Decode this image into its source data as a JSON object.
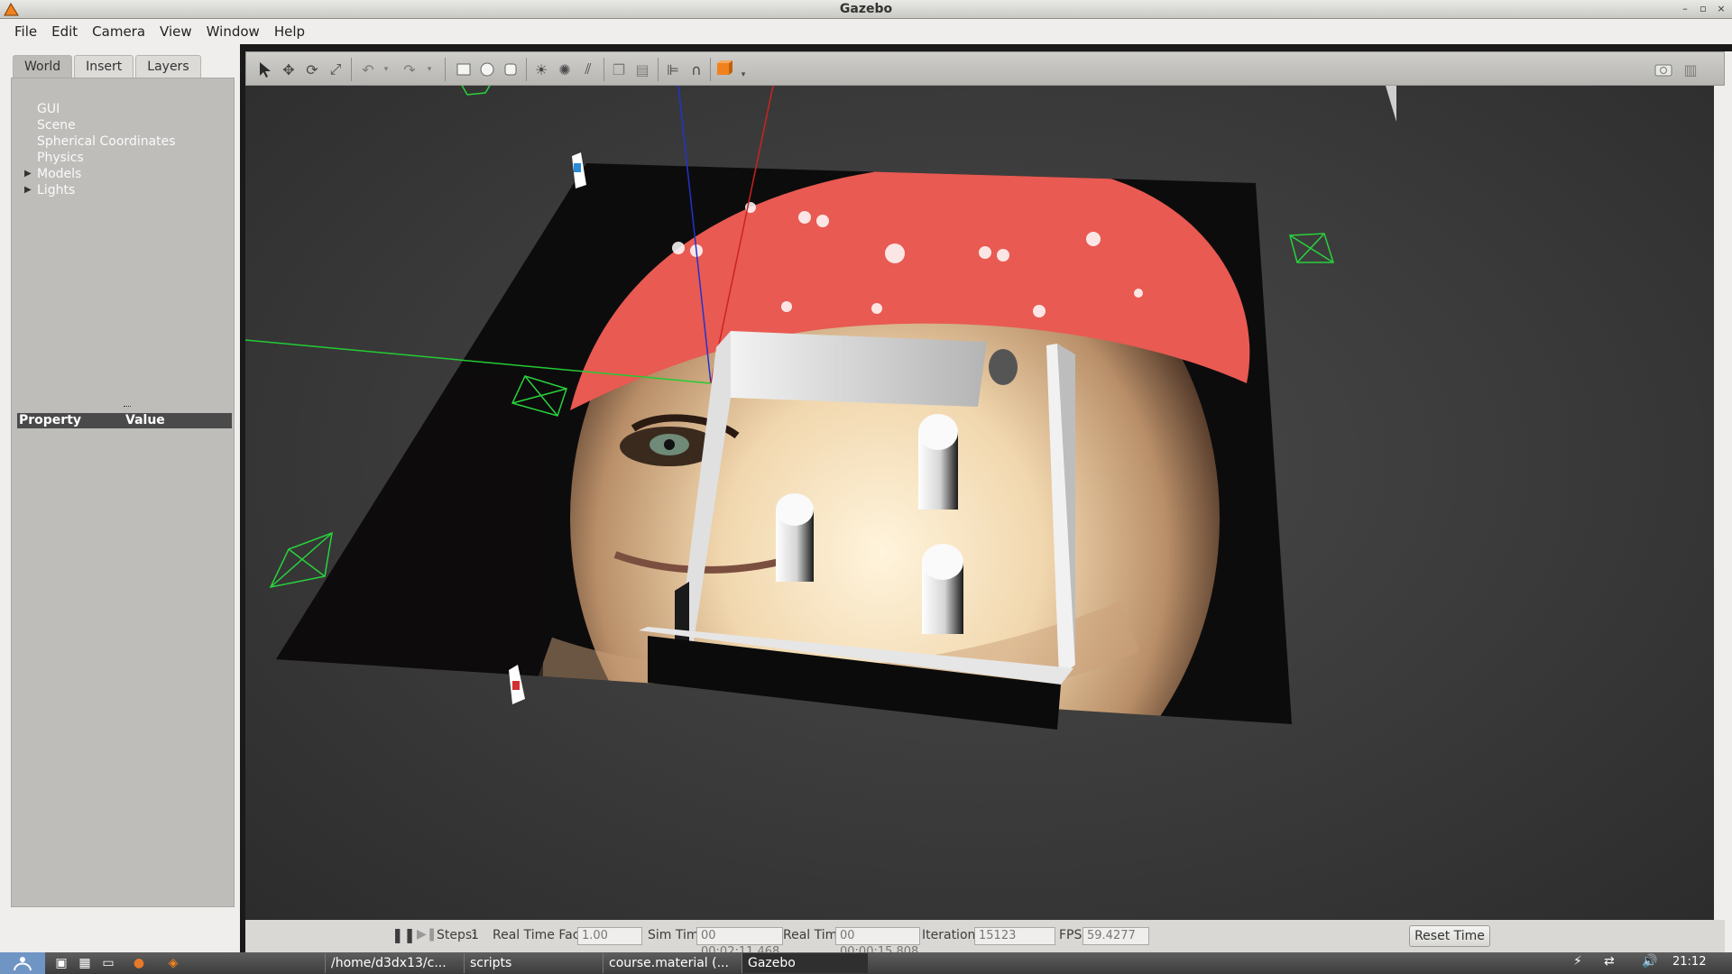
{
  "window": {
    "title": "Gazebo",
    "controls": [
      "–",
      "▫",
      "×"
    ]
  },
  "menu": [
    "File",
    "Edit",
    "Camera",
    "View",
    "Window",
    "Help"
  ],
  "left_panel": {
    "tabs": [
      "World",
      "Insert",
      "Layers"
    ],
    "active_tab": "World",
    "tree": [
      "GUI",
      "Scene",
      "Spherical Coordinates",
      "Physics",
      "Models",
      "Lights"
    ],
    "property_headers": {
      "property": "Property",
      "value": "Value"
    }
  },
  "toolbar": {
    "tools": [
      "select-icon",
      "translate-icon",
      "rotate-icon",
      "scale-icon",
      "undo-icon",
      "redo-icon",
      "box-icon",
      "sphere-icon",
      "cylinder-icon",
      "point-light-icon",
      "spot-light-icon",
      "directional-light-icon",
      "copy-icon",
      "paste-icon",
      "align-icon",
      "snap-icon",
      "view-angle-icon",
      "screenshot-icon",
      "log-icon"
    ]
  },
  "bottom_bar": {
    "steps_label": "Steps:",
    "steps_value": "1",
    "rtf_label": "Real Time Factor:",
    "rtf_value": "1.00",
    "sim_time_label": "Sim Time:",
    "sim_time_value": "00 00:02:11.468",
    "real_time_label": "Real Time:",
    "real_time_value": "00 00:00:15.808",
    "iterations_label": "Iterations:",
    "iterations_value": "15123",
    "fps_label": "FPS:",
    "fps_value": "59.4277",
    "reset_label": "Reset Time"
  },
  "taskbar": {
    "tasks": [
      "/home/d3dx13/c...",
      "scripts",
      "course.material (...",
      "Gazebo"
    ],
    "active_task": "Gazebo",
    "clock": "21:12"
  },
  "colors": {
    "accent_orange": "#f0821e",
    "camera_green": "#28d23c",
    "bandana_red": "#e85a52"
  }
}
